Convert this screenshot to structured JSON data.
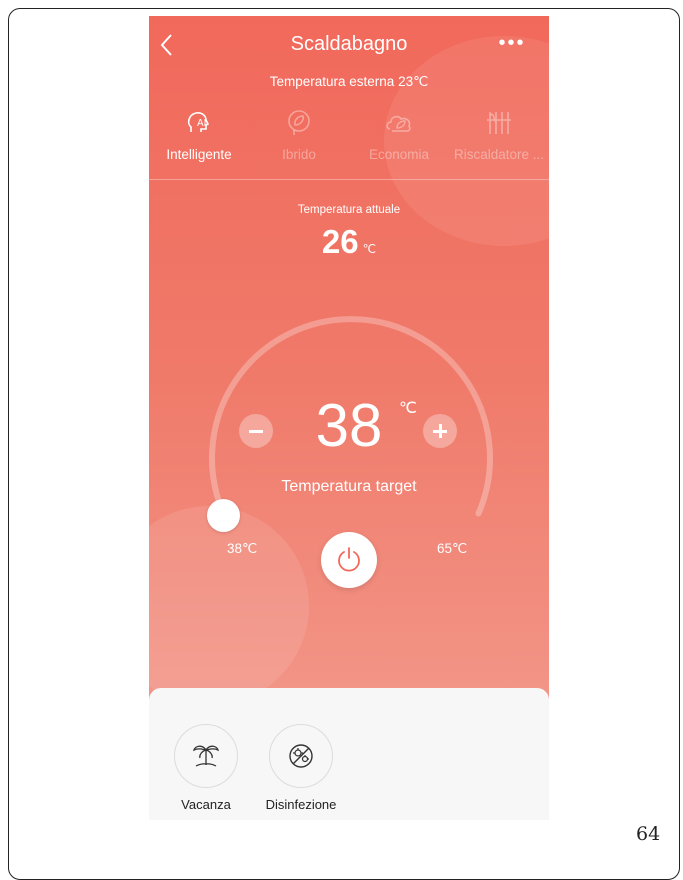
{
  "header": {
    "title": "Scaldabagno"
  },
  "external_temperature": "Temperatura esterna 23℃",
  "modes": [
    {
      "label": "Intelligente",
      "icon": "ai-head-icon",
      "active": true
    },
    {
      "label": "Ibrido",
      "icon": "leaf-circle-icon",
      "active": false
    },
    {
      "label": "Economia",
      "icon": "leaf-cloud-icon",
      "active": false
    },
    {
      "label": "Riscaldatore ...",
      "icon": "heater-icon",
      "active": false
    }
  ],
  "current": {
    "label": "Temperatura attuale",
    "value": "26",
    "unit": "℃"
  },
  "target": {
    "value": "38",
    "unit": "℃",
    "label": "Temperatura target"
  },
  "range": {
    "min_label": "38℃",
    "max_label": "65℃"
  },
  "features": [
    {
      "label": "Vacanza",
      "icon": "palm-tree-icon"
    },
    {
      "label": "Disinfezione",
      "icon": "disinfection-icon"
    }
  ],
  "page_number": "64",
  "colors": {
    "accent": "#f1695b",
    "panel": "#f7f7f7"
  }
}
